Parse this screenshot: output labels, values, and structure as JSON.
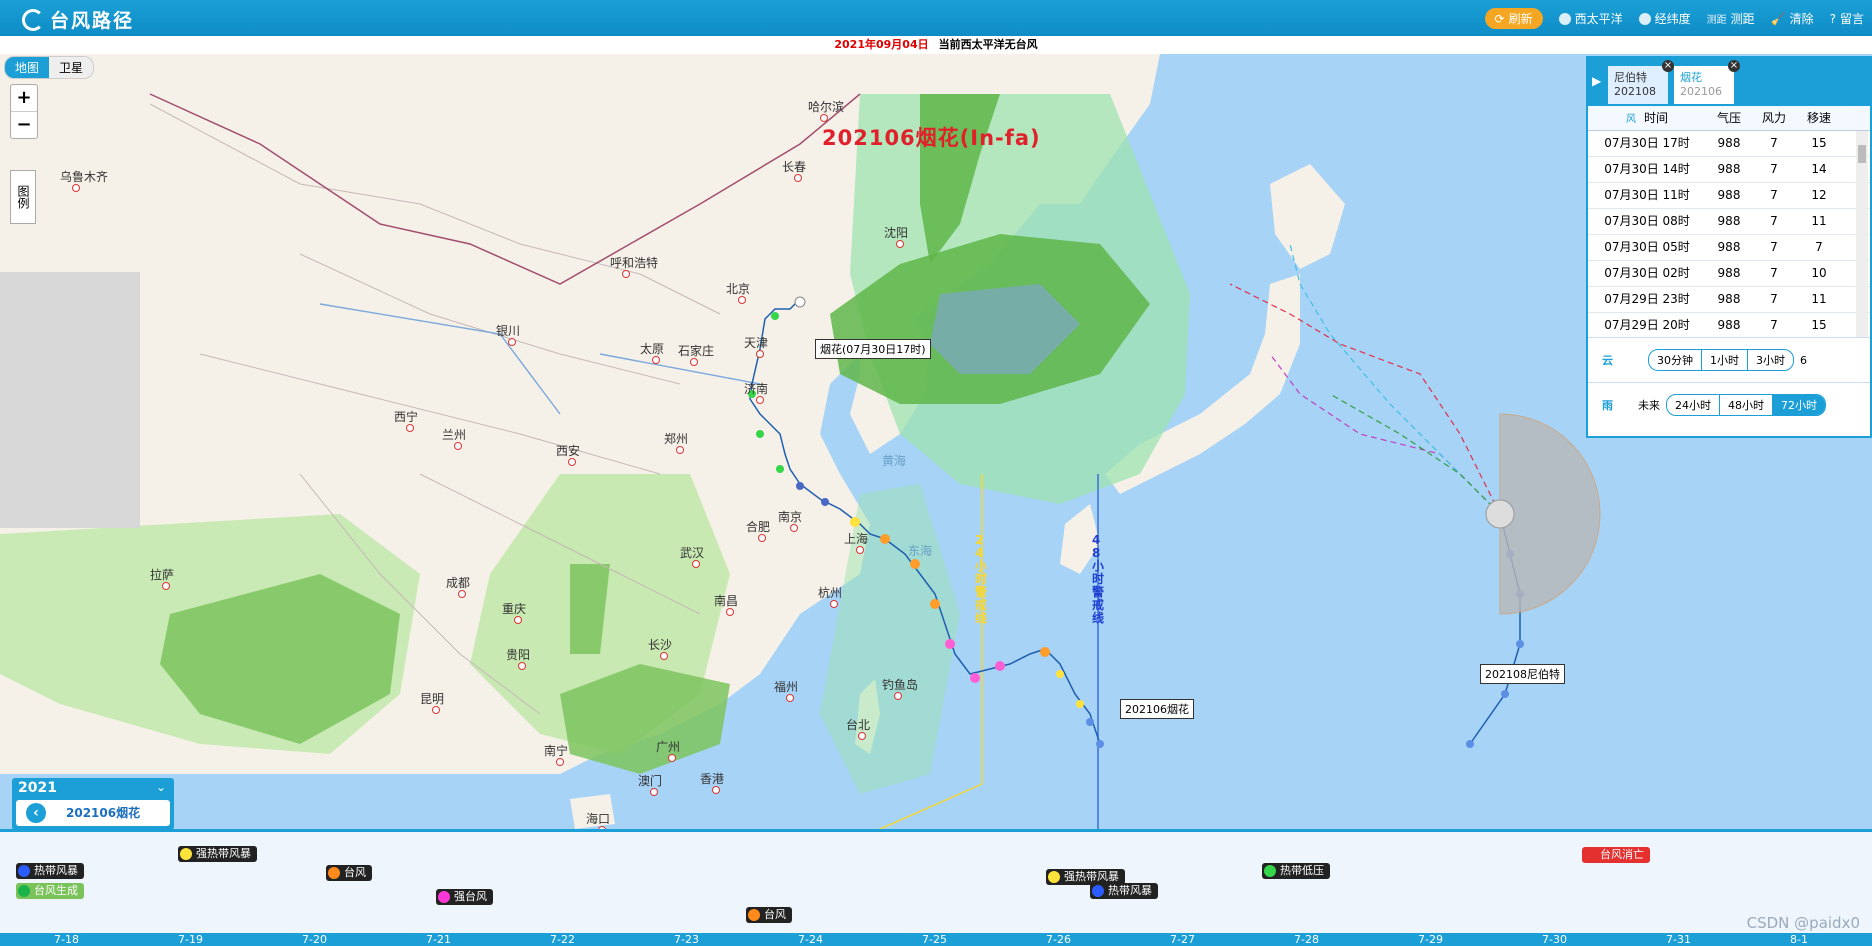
{
  "app": {
    "title": "台风路径"
  },
  "toolbar": {
    "refresh": "刷新",
    "pacific": "西太平洋",
    "latlon": "经纬度",
    "measure_img": "测距",
    "measure": "测距",
    "clear": "清除",
    "message": "留言"
  },
  "notice": {
    "date": "2021年09月04日",
    "text": "当前西太平洋无台风"
  },
  "map": {
    "type_map": "地图",
    "type_satellite": "卫星",
    "zoom_in": "+",
    "zoom_out": "−",
    "legend": "图例",
    "storm_title": "202106烟花(In-fa)",
    "sea_labels": [
      "黄海",
      "东海"
    ],
    "cities": [
      "乌鲁木齐",
      "哈尔滨",
      "长春",
      "沈阳",
      "呼和浩特",
      "北京",
      "天津",
      "银川",
      "太原",
      "石家庄",
      "济南",
      "西宁",
      "兰州",
      "西安",
      "郑州",
      "合肥",
      "南京",
      "上海",
      "拉萨",
      "成都",
      "武汉",
      "杭州",
      "重庆",
      "贵阳",
      "长沙",
      "南昌",
      "福州",
      "钓鱼岛",
      "台北",
      "昆明",
      "南宁",
      "广州",
      "澳门",
      "香港",
      "海口"
    ],
    "track_labels": {
      "infa_current": "烟花(07月30日17时)",
      "infa_end": "202106烟花",
      "nepartak_end": "202108尼伯特"
    },
    "warning_24": "24小时警戒线",
    "warning_48": "48小时警戒线"
  },
  "panel": {
    "tabs": [
      {
        "name": "尼伯特",
        "code": "202108"
      },
      {
        "name": "烟花",
        "code": "202106"
      }
    ],
    "close": "×",
    "wind_icon_label": "风",
    "headers": [
      "时间",
      "气压",
      "风力",
      "移速"
    ],
    "rows": [
      [
        "07月30日 17时",
        "988",
        "7",
        "15"
      ],
      [
        "07月30日 14时",
        "988",
        "7",
        "14"
      ],
      [
        "07月30日 11时",
        "988",
        "7",
        "12"
      ],
      [
        "07月30日 08时",
        "988",
        "7",
        "11"
      ],
      [
        "07月30日 05时",
        "988",
        "7",
        "7"
      ],
      [
        "07月30日 02时",
        "988",
        "7",
        "10"
      ],
      [
        "07月29日 23时",
        "988",
        "7",
        "11"
      ],
      [
        "07月29日 20时",
        "988",
        "7",
        "15"
      ]
    ],
    "cloud_label": "云",
    "cloud_options": [
      "30分钟",
      "1小时",
      "3小时"
    ],
    "cloud_more": "6",
    "rain_label": "雨",
    "rain_future": "未来",
    "rain_options": [
      "24小时",
      "48小时",
      "72小时"
    ]
  },
  "year": {
    "value": "2021",
    "selected": "202106烟花"
  },
  "timeline": {
    "events": [
      {
        "label": "热带风暴",
        "color": "#2b5cff"
      },
      {
        "label": "台风生成",
        "color": "#19b34a"
      },
      {
        "label": "强热带风暴",
        "color": "#ffe23a"
      },
      {
        "label": "台风",
        "color": "#ff8a1c"
      },
      {
        "label": "强台风",
        "color": "#ff37d6"
      },
      {
        "label": "台风",
        "color": "#ff8a1c"
      },
      {
        "label": "强热带风暴",
        "color": "#ffe23a"
      },
      {
        "label": "热带风暴",
        "color": "#2b5cff"
      },
      {
        "label": "热带低压",
        "color": "#35d64a"
      },
      {
        "label": "台风消亡",
        "color": "#e53030"
      }
    ],
    "dates": [
      "7-18",
      "7-19",
      "7-20",
      "7-21",
      "7-22",
      "7-23",
      "7-24",
      "7-25",
      "7-26",
      "7-27",
      "7-28",
      "7-29",
      "7-30",
      "7-31",
      "8-1"
    ]
  },
  "watermark": "CSDN @paidx0",
  "colors": {
    "brand": "#1b9fd6",
    "title_red": "#e0202a",
    "infa_track_early": "#2ecc40",
    "rain_green": "#5fb64a"
  }
}
